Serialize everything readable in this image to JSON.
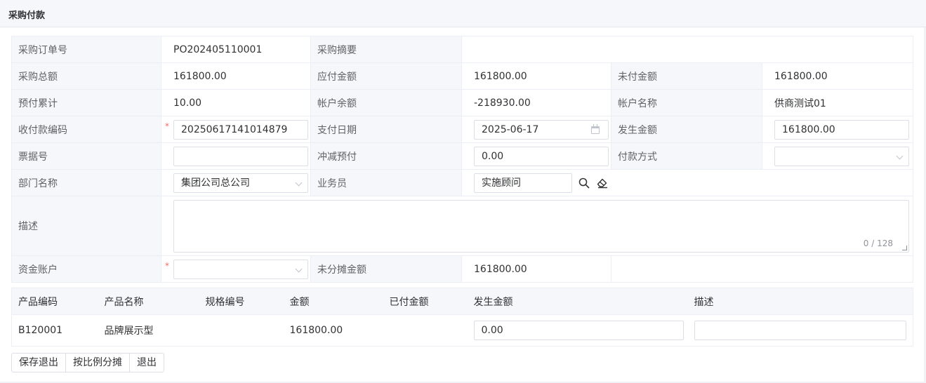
{
  "header": {
    "title": "采购付款"
  },
  "form": {
    "order_no_label": "采购订单号",
    "order_no": "PO202405110001",
    "summary_label": "采购摘要",
    "summary": "",
    "total_label": "采购总额",
    "total": "161800.00",
    "payable_label": "应付金额",
    "payable": "161800.00",
    "unpaid_label": "未付金额",
    "unpaid": "161800.00",
    "prepaid_label": "预付累计",
    "prepaid": "10.00",
    "balance_label": "帐户余额",
    "balance": "-218930.00",
    "account_name_label": "帐户名称",
    "account_name": "供商测试01",
    "payment_code_label": "收付款编码",
    "payment_code": "20250617141014879",
    "pay_date_label": "支付日期",
    "pay_date": "2025-06-17",
    "amount_label": "发生金额",
    "amount": "161800.00",
    "bill_no_label": "票据号",
    "bill_no": "",
    "offset_label": "冲减预付",
    "offset": "0.00",
    "pay_method_label": "付款方式",
    "pay_method": "",
    "dept_label": "部门名称",
    "dept": "集团公司总公司",
    "salesman_label": "业务员",
    "salesman": "实施顾问",
    "desc_label": "描述",
    "desc": "",
    "desc_counter": "0 / 128",
    "fund_account_label": "资金账户",
    "fund_account": "",
    "unalloc_label": "未分摊金额",
    "unalloc": "161800.00",
    "required_mark": "*"
  },
  "detail": {
    "headers": [
      "产品编码",
      "产品名称",
      "规格编号",
      "金额",
      "已付金额",
      "发生金额",
      "描述"
    ],
    "rows": [
      {
        "code": "B120001",
        "name": "品牌展示型",
        "spec": "",
        "amount": "161800.00",
        "paid": "",
        "occur": "0.00",
        "desc": ""
      }
    ]
  },
  "buttons": {
    "save_exit": "保存退出",
    "allocate": "按比例分摊",
    "exit": "退出"
  }
}
